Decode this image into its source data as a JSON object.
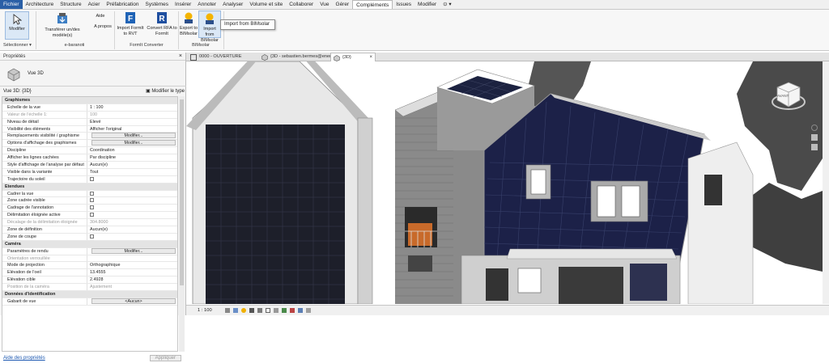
{
  "menu": {
    "items": [
      "Fichier",
      "Architecture",
      "Structure",
      "Acier",
      "Préfabrication",
      "Systèmes",
      "Insérer",
      "Annoter",
      "Analyser",
      "Volume et site",
      "Collaborer",
      "Vue",
      "Gérer",
      "Compléments",
      "Issues",
      "Modifier"
    ],
    "active": "Compléments"
  },
  "ribbon": {
    "modify_label": "Modifier",
    "select_label": "Sélectionner",
    "transfer_label": "Transférer un/des modèle(s)",
    "ebaranoti_group": "e-baranoti",
    "help_label": "Aide",
    "about_label": "A propos",
    "import_formit_label": "Import FormIt to RVT",
    "convert_rfa_label": "Convert RFA to FormIt",
    "formit_group": "FormIt Converter",
    "export_bimsolar_label": "Export to BIMsolar",
    "import_bimsolar_label": "Import from BIMsolar",
    "bimsolar_group": "BIMsolar",
    "tooltip": "Import from BIMsolar"
  },
  "properties": {
    "title": "Propriétés",
    "close": "×",
    "type_name": "Vue 3D",
    "type_selector": "Vue 3D: {3D}",
    "edit_type": "Modifier le type",
    "footer_link": "Aide des propriétés",
    "apply": "Appliquer",
    "rows": [
      {
        "kind": "sec",
        "name": "Graphismes"
      },
      {
        "kind": "text",
        "name": "Echelle de la vue",
        "value": "1 : 100"
      },
      {
        "kind": "grey",
        "name": "Valeur de l'échelle    1:",
        "value": "100"
      },
      {
        "kind": "text",
        "name": "Niveau de détail",
        "value": "Elevé"
      },
      {
        "kind": "text",
        "name": "Visibilité des éléments",
        "value": "Afficher l'original"
      },
      {
        "kind": "btn",
        "name": "Remplacements visibilité / graphisme",
        "value": "Modifier..."
      },
      {
        "kind": "btn",
        "name": "Options d'affichage des graphismes",
        "value": "Modifier..."
      },
      {
        "kind": "text",
        "name": "Discipline",
        "value": "Coordination"
      },
      {
        "kind": "text",
        "name": "Afficher les lignes cachées",
        "value": "Par discipline"
      },
      {
        "kind": "text",
        "name": "Style d'affichage de l'analyse par défaut",
        "value": "Aucun(e)"
      },
      {
        "kind": "text",
        "name": "Visible dans la variante",
        "value": "Tout"
      },
      {
        "kind": "chk",
        "name": "Trajectoire du soleil",
        "value": ""
      },
      {
        "kind": "sec",
        "name": "Etendues"
      },
      {
        "kind": "chk",
        "name": "Cadrer la vue",
        "value": ""
      },
      {
        "kind": "chk",
        "name": "Zone cadrée visible",
        "value": ""
      },
      {
        "kind": "chk",
        "name": "Cadrage de l'annotation",
        "value": ""
      },
      {
        "kind": "chk",
        "name": "Délimitation éloignée active",
        "value": ""
      },
      {
        "kind": "grey",
        "name": "Décalage de la délimitation éloignée",
        "value": "304.8000"
      },
      {
        "kind": "text",
        "name": "Zone de définition",
        "value": "Aucun(e)"
      },
      {
        "kind": "chk",
        "name": "Zone de coupe",
        "value": ""
      },
      {
        "kind": "sec",
        "name": "Caméra"
      },
      {
        "kind": "btn",
        "name": "Paramètres de rendu",
        "value": "Modifier..."
      },
      {
        "kind": "grey",
        "name": "Orientation verrouillée",
        "value": ""
      },
      {
        "kind": "text",
        "name": "Mode de projection",
        "value": "Orthographique"
      },
      {
        "kind": "text",
        "name": "Elévation de l'oeil",
        "value": "13.4555"
      },
      {
        "kind": "text",
        "name": "Elévation cible",
        "value": "2.4928"
      },
      {
        "kind": "grey",
        "name": "Position de la caméra",
        "value": "Ajustement"
      },
      {
        "kind": "sec",
        "name": "Données d'identification"
      },
      {
        "kind": "btn",
        "name": "Gabarit de vue",
        "value": "<Aucun>"
      }
    ]
  },
  "tabs": [
    {
      "label": "0000 - OUVERTURE"
    },
    {
      "label": "{3D - sebastien.bermes@enerbim.c..."
    },
    {
      "label": "{3D}",
      "active": true
    }
  ],
  "status": {
    "scale": "1 : 100"
  },
  "viewcube": {
    "label": "AVANT"
  }
}
